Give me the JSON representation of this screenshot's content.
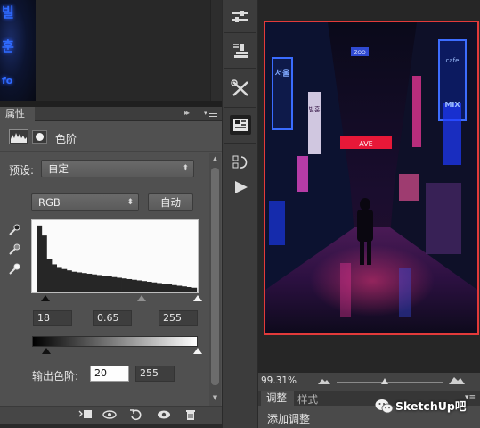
{
  "thumbnail": {
    "glyphs": [
      "빌",
      "훈",
      "fo"
    ]
  },
  "properties_panel": {
    "tab_label": "属性",
    "collapse_glyph": "▸▸",
    "adjustment_title": "色阶",
    "preset": {
      "label": "预设:",
      "value": "自定"
    },
    "channel": {
      "value": "RGB"
    },
    "auto_button": "自动",
    "input_levels": {
      "black": "18",
      "gamma": "0.65",
      "white": "255"
    },
    "output_levels": {
      "label": "输出色阶:",
      "black": "20",
      "white": "255"
    },
    "histogram_profile": [
      1,
      0.85,
      0.5,
      0.42,
      0.38,
      0.35,
      0.33,
      0.31,
      0.3,
      0.29,
      0.28,
      0.27,
      0.26,
      0.25,
      0.24,
      0.23,
      0.22,
      0.21,
      0.2,
      0.19,
      0.18,
      0.17,
      0.16,
      0.15,
      0.14,
      0.13,
      0.12,
      0.11,
      0.1,
      0.09,
      0.08,
      0.07
    ],
    "input_slider_levels": {
      "black": 18,
      "gamma_fraction": 0.63,
      "white": 255
    },
    "output_slider_levels": {
      "black": 20,
      "white": 255
    }
  },
  "canvas": {
    "zoom": "99.31%",
    "zoom_fraction": 0.45,
    "photo_signs": [
      "서울",
      "빌훈",
      "ZOO",
      "MIX",
      "cafe",
      "AVE"
    ]
  },
  "adjustments_panel": {
    "tabs": [
      "调整",
      "样式"
    ],
    "menu_glyph": "▾≡",
    "add_adjustment": "添加调整"
  },
  "watermark": {
    "text": "SketchUp吧"
  },
  "colors": {
    "accent_border": "#e33a3a",
    "panel_bg": "#505050",
    "dark_bg": "#282828"
  },
  "icons": {
    "tools": [
      "adjustment-sliders-icon",
      "stamp-icon",
      "tools-cross-icon",
      "properties-icon",
      "history-icon",
      "play-icon"
    ],
    "footer": [
      "clip-to-layer-icon",
      "view-previous-icon",
      "reset-icon",
      "visibility-eye-icon",
      "trash-icon"
    ],
    "eyedroppers": [
      "black-eyedropper-icon",
      "gray-eyedropper-icon",
      "white-eyedropper-icon"
    ]
  }
}
